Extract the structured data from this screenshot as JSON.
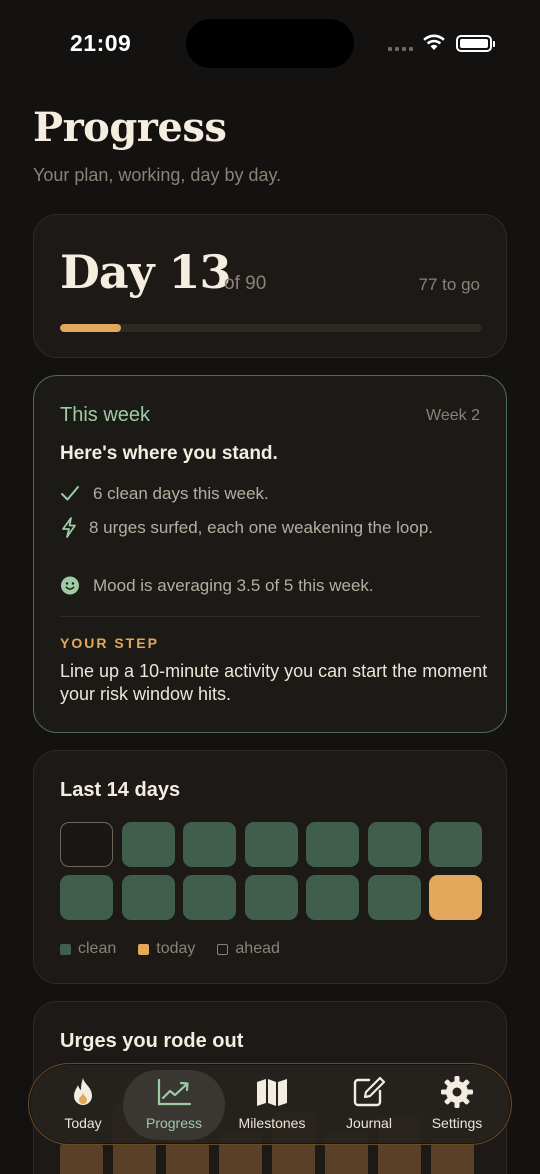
{
  "status": {
    "time": "21:09"
  },
  "header": {
    "title": "Progress",
    "subtitle": "Your plan, working, day by day."
  },
  "day_card": {
    "day_label": "Day 13",
    "of_total": "of 90",
    "remaining": "77 to go",
    "progress": 0.144
  },
  "week_card": {
    "label": "This week",
    "week": "Week 2",
    "heading": "Here's where you stand.",
    "items": [
      {
        "icon": "check-icon",
        "text": "6 clean days this week."
      },
      {
        "icon": "bolt-icon",
        "text": "8 urges surfed, each one weakening the loop."
      },
      {
        "icon": "smile-icon",
        "text": "Mood is averaging 3.5 of 5 this week."
      }
    ],
    "step_label": "YOUR STEP",
    "step_text": "Line up a 10-minute activity you can start the moment your risk window hits."
  },
  "days_card": {
    "title": "Last 14 days",
    "cells": [
      "ahead",
      "clean",
      "clean",
      "clean",
      "clean",
      "clean",
      "clean",
      "clean",
      "clean",
      "clean",
      "clean",
      "clean",
      "clean",
      "today"
    ],
    "legend": {
      "clean": "clean",
      "today": "today",
      "ahead": "ahead"
    },
    "colors": {
      "clean": "#3f5e4b",
      "today": "#e3a85b"
    }
  },
  "urges_card": {
    "title": "Urges you rode out"
  },
  "tabs": [
    {
      "label": "Today",
      "icon": "flame-icon"
    },
    {
      "label": "Progress",
      "icon": "chart-line-icon"
    },
    {
      "label": "Milestones",
      "icon": "map-icon"
    },
    {
      "label": "Journal",
      "icon": "compose-icon"
    },
    {
      "label": "Settings",
      "icon": "gear-icon"
    }
  ]
}
